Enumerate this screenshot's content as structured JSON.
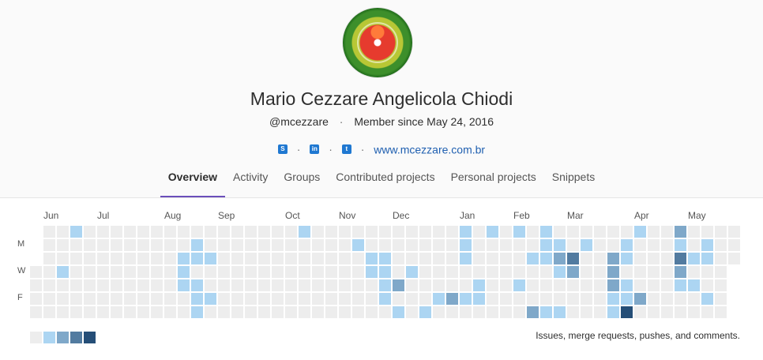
{
  "profile": {
    "name": "Mario Cezzare Angelicola Chiodi",
    "username": "@mcezzare",
    "member_since": "Member since May 24, 2016",
    "website": "www.mcezzare.com.br",
    "social_icons": [
      "skype-icon",
      "linkedin-icon",
      "twitter-icon"
    ]
  },
  "tabs": [
    "Overview",
    "Activity",
    "Groups",
    "Contributed projects",
    "Personal projects",
    "Snippets"
  ],
  "active_tab": "Overview",
  "calendar": {
    "months": [
      "Jun",
      "Jul",
      "Aug",
      "Sep",
      "Oct",
      "Nov",
      "Dec",
      "Jan",
      "Feb",
      "Mar",
      "Apr",
      "May"
    ],
    "day_labels": [
      "M",
      "W",
      "F"
    ],
    "colors": [
      "#ededed",
      "#acd5f2",
      "#7fa8c9",
      "#527ba0",
      "#254e77"
    ],
    "caption": "Issues, merge requests, pushes, and comments.",
    "cells": [
      [
        2,
        3,
        1
      ],
      [
        3,
        0,
        1
      ],
      [
        11,
        2,
        1
      ],
      [
        11,
        3,
        1
      ],
      [
        11,
        4,
        1
      ],
      [
        12,
        1,
        1
      ],
      [
        12,
        2,
        1
      ],
      [
        12,
        4,
        1
      ],
      [
        12,
        5,
        1
      ],
      [
        12,
        6,
        1
      ],
      [
        13,
        2,
        1
      ],
      [
        13,
        5,
        1
      ],
      [
        20,
        0,
        1
      ],
      [
        24,
        1,
        1
      ],
      [
        25,
        2,
        1
      ],
      [
        25,
        3,
        1
      ],
      [
        26,
        2,
        1
      ],
      [
        26,
        3,
        1
      ],
      [
        26,
        4,
        1
      ],
      [
        26,
        5,
        1
      ],
      [
        27,
        4,
        2
      ],
      [
        27,
        6,
        1
      ],
      [
        28,
        3,
        1
      ],
      [
        29,
        6,
        1
      ],
      [
        30,
        5,
        1
      ],
      [
        31,
        5,
        2
      ],
      [
        32,
        0,
        1
      ],
      [
        32,
        1,
        1
      ],
      [
        32,
        2,
        1
      ],
      [
        32,
        5,
        1
      ],
      [
        33,
        4,
        1
      ],
      [
        33,
        5,
        1
      ],
      [
        34,
        0,
        1
      ],
      [
        36,
        0,
        1
      ],
      [
        36,
        4,
        1
      ],
      [
        37,
        2,
        1
      ],
      [
        37,
        6,
        2
      ],
      [
        38,
        0,
        1
      ],
      [
        38,
        1,
        1
      ],
      [
        38,
        2,
        1
      ],
      [
        38,
        6,
        1
      ],
      [
        39,
        1,
        1
      ],
      [
        39,
        2,
        2
      ],
      [
        39,
        3,
        1
      ],
      [
        39,
        6,
        1
      ],
      [
        40,
        2,
        3
      ],
      [
        40,
        3,
        2
      ],
      [
        41,
        1,
        1
      ],
      [
        43,
        2,
        2
      ],
      [
        43,
        3,
        2
      ],
      [
        43,
        4,
        2
      ],
      [
        43,
        5,
        1
      ],
      [
        43,
        6,
        1
      ],
      [
        44,
        1,
        1
      ],
      [
        44,
        2,
        1
      ],
      [
        44,
        4,
        1
      ],
      [
        44,
        5,
        1
      ],
      [
        44,
        6,
        4
      ],
      [
        45,
        0,
        1
      ],
      [
        45,
        5,
        2
      ],
      [
        48,
        0,
        2
      ],
      [
        48,
        1,
        1
      ],
      [
        48,
        2,
        3
      ],
      [
        48,
        3,
        2
      ],
      [
        48,
        4,
        1
      ],
      [
        49,
        2,
        1
      ],
      [
        49,
        4,
        1
      ],
      [
        50,
        1,
        1
      ],
      [
        50,
        2,
        1
      ],
      [
        50,
        5,
        1
      ]
    ]
  }
}
